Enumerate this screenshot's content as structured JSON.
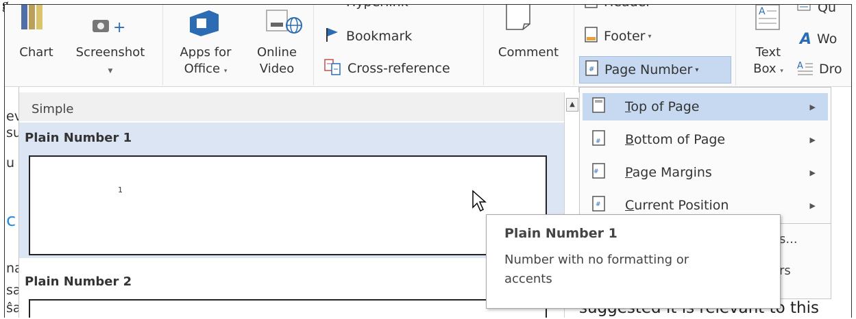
{
  "ribbon": {
    "chart_label": "Chart",
    "screenshot_label": "Screenshot",
    "apps_line1": "Apps for",
    "apps_line2": "Office",
    "online_line1": "Online",
    "online_line2": "Video",
    "hyperlink_label": "Hyperlink",
    "bookmark_label": "Bookmark",
    "crossref_label": "Cross-reference",
    "comment_label": "Comment",
    "header_label": "Header",
    "footer_label": "Footer",
    "page_number_label": "Page Number",
    "textbox_line1": "Text",
    "textbox_line2": "Box",
    "quick_parts_label": "Qu",
    "wordart_label": "Wo",
    "dropcap_label": "Dro"
  },
  "gallery": {
    "section_header": "Simple",
    "items": [
      {
        "title": "Plain Number 1",
        "preview_number": "1"
      },
      {
        "title": "Plain Number 2"
      }
    ]
  },
  "menu": {
    "items": [
      {
        "label": "Top of Page"
      },
      {
        "label": "Bottom of Page"
      },
      {
        "label": "Page Margins"
      },
      {
        "label": "Current Position"
      }
    ],
    "partial_1": "s...",
    "partial_2": "rs"
  },
  "tooltip": {
    "title": "Plain Number 1",
    "description": "Number with no formatting or accents"
  },
  "document": {
    "bottom_text": "suggested it is relevant to this",
    "left_fragments": [
      "ev",
      "su",
      "u",
      "c",
      "na",
      "sa",
      "ŝa"
    ]
  },
  "page_corner_text": "g",
  "colors": {
    "selection": "#dbe5f3",
    "menu_highlight": "#c6d9f1",
    "accent_blue": "#2b579a"
  }
}
